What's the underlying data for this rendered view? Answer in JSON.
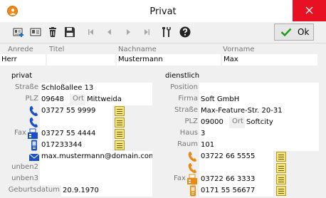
{
  "window": {
    "title": "Privat"
  },
  "toolbar": {
    "ok_label": "Ok"
  },
  "name": {
    "anrede_label": "Anrede",
    "titel_label": "Titel",
    "nachname_label": "Nachname",
    "vorname_label": "Vorname",
    "anrede": "Herr",
    "titel": "",
    "nachname": "Mustermann",
    "vorname": "Max"
  },
  "privat": {
    "heading": "privat",
    "strasse_label": "Straße",
    "strasse": "Schloßallee 13",
    "plz_label": "PLZ",
    "plz": "09648",
    "ort_label": "Ort",
    "ort": "Mittweida",
    "phone1": "03727 55 9999",
    "phone2": "",
    "fax_label": "Fax",
    "fax": "03727 55 4444",
    "mobile": "017233344",
    "email": "max.mustermann@domain.com",
    "unben2_label": "unben2",
    "unben2": "",
    "unben3_label": "unben3",
    "unben3": "",
    "geburtsdatum_label": "Geburtsdatum",
    "geburtsdatum": "20.9.1970"
  },
  "dienstlich": {
    "heading": "dienstlich",
    "position_label": "Position",
    "position": "",
    "firma_label": "Firma",
    "firma": "Soft GmbH",
    "strasse_label": "Straße",
    "strasse": "Max-Feature-Str. 20-31",
    "plz_label": "PLZ",
    "plz": "09000",
    "ort_label": "Ort",
    "ort": "Softcity",
    "haus_label": "Haus",
    "haus": "3",
    "raum_label": "Raum",
    "raum": "101",
    "phone1": "03722 66 5555",
    "phone2": "",
    "fax_label": "Fax",
    "fax": "03722 66 3333",
    "mobile": "0171 55 56677"
  }
}
